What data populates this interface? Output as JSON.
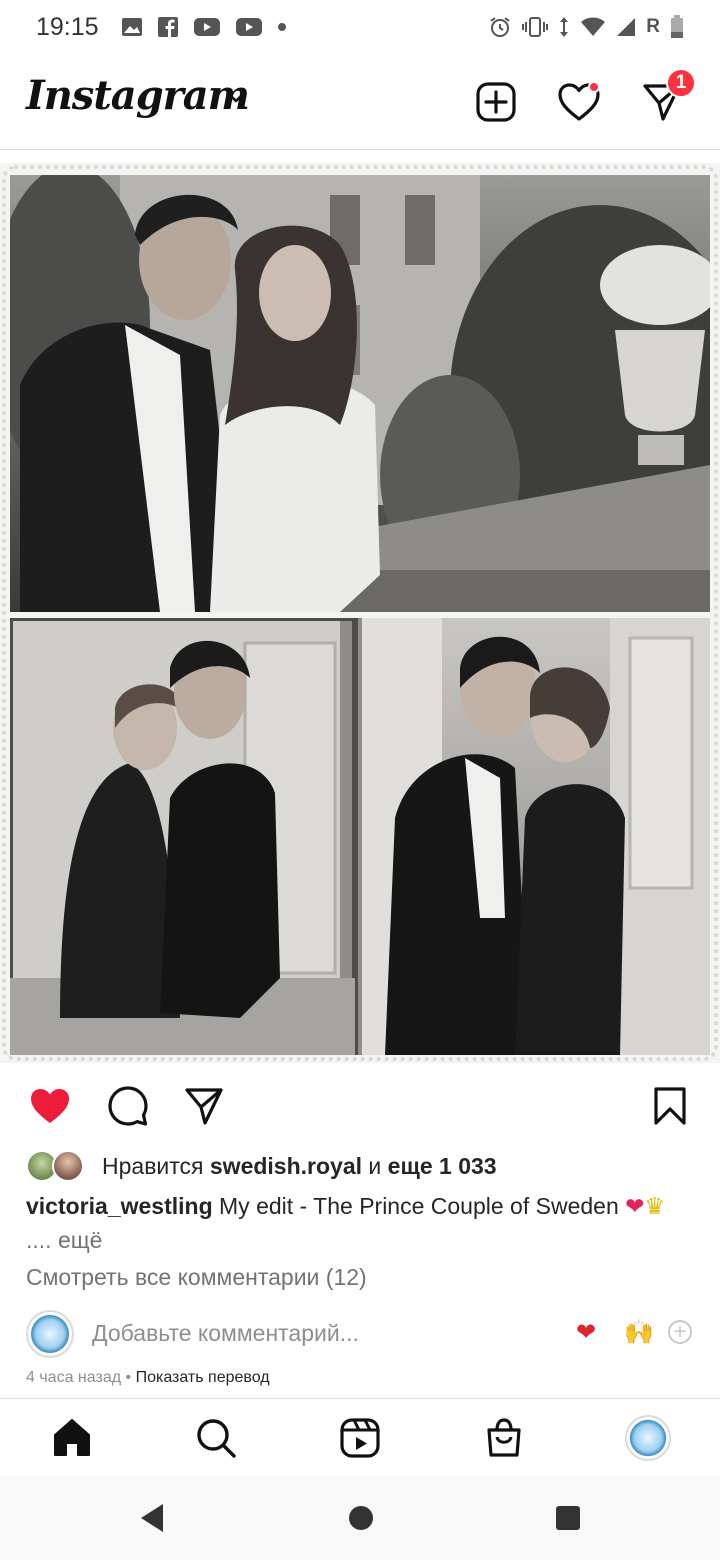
{
  "status_bar": {
    "time": "19:15",
    "network_label": "R",
    "left_icons": [
      "gallery-icon",
      "facebook-icon",
      "youtube-icon",
      "youtube-icon",
      "dot-icon"
    ],
    "right_icons": [
      "alarm-icon",
      "vibrate-icon",
      "data-arrows-icon",
      "wifi-icon",
      "signal-icon",
      "battery-icon"
    ]
  },
  "header": {
    "logo": "Instagram",
    "dm_badge_count": "1",
    "has_notification_dot": true
  },
  "post": {
    "liked": true,
    "likes": {
      "prefix": "Нравится",
      "user": "swedish.royal",
      "conj": "и",
      "others": "еще 1 033"
    },
    "caption": {
      "user": "victoria_westling",
      "text": "My edit - The Prince Couple of Sweden",
      "emoji": [
        "❤",
        "♛"
      ],
      "more": ".... ещё"
    },
    "view_comments": "Смотреть все комментарии (12)",
    "comment_placeholder": "Добавьте комментарий...",
    "quick_emojis": [
      "❤",
      "🙌"
    ],
    "time_ago": "4 часа назад",
    "translate": "Показать перевод"
  },
  "bottom_nav": {
    "items": [
      "home-icon",
      "search-icon",
      "reels-icon",
      "shop-icon",
      "profile-avatar"
    ]
  },
  "colors": {
    "accent_red": "#ff3040",
    "like_red": "#ed1c3a",
    "secondary_text": "#737373",
    "divider": "#dbdbdb"
  }
}
